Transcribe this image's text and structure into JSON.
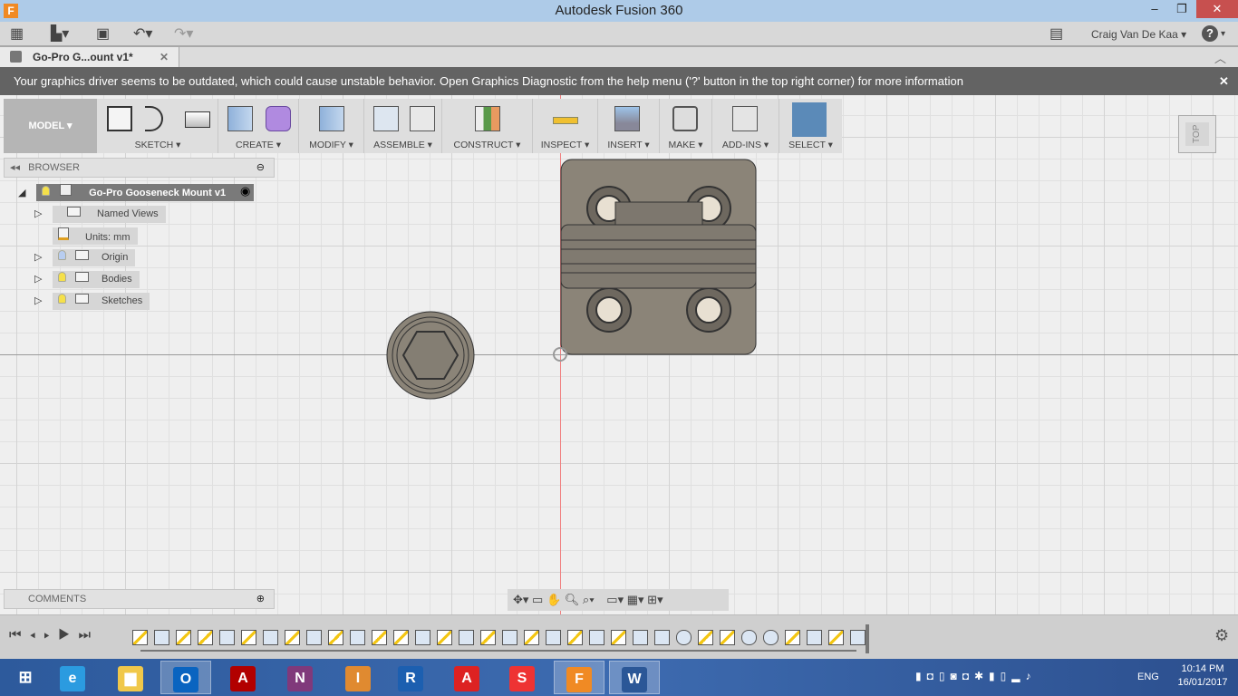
{
  "window": {
    "title": "Autodesk Fusion 360",
    "app_icon_letter": "F",
    "minimize": "‒",
    "restore": "❐",
    "close": "✕"
  },
  "quick_access": {
    "user_name": "Craig Van De Kaa",
    "help": "?"
  },
  "document_tab": {
    "label": "Go-Pro G...ount v1*",
    "close": "✕"
  },
  "banner": {
    "message": "Your graphics driver seems to be outdated, which could cause unstable behavior. Open Graphics Diagnostic from the help menu ('?' button in the top right corner) for more information",
    "close": "✕"
  },
  "toolbar": {
    "workspace": "MODEL ▾",
    "groups": [
      {
        "label": "SKETCH ▾"
      },
      {
        "label": "CREATE ▾"
      },
      {
        "label": "MODIFY ▾"
      },
      {
        "label": "ASSEMBLE ▾"
      },
      {
        "label": "CONSTRUCT ▾"
      },
      {
        "label": "INSPECT ▾"
      },
      {
        "label": "INSERT ▾"
      },
      {
        "label": "MAKE ▾"
      },
      {
        "label": "ADD-INS ▾"
      },
      {
        "label": "SELECT ▾"
      }
    ],
    "accent": "#5b8ab8"
  },
  "viewcube": {
    "label": "TOP"
  },
  "browser": {
    "title": "BROWSER",
    "root": "Go-Pro Gooseneck Mount v1",
    "items": [
      {
        "label": "Named Views",
        "expandable": true,
        "visibility": false
      },
      {
        "label": "Units: mm",
        "expandable": false,
        "visibility": false
      },
      {
        "label": "Origin",
        "expandable": true,
        "visibility": true,
        "bulb": "off"
      },
      {
        "label": "Bodies",
        "expandable": true,
        "visibility": true,
        "bulb": "on"
      },
      {
        "label": "Sketches",
        "expandable": true,
        "visibility": true,
        "bulb": "on"
      }
    ]
  },
  "comments": {
    "title": "COMMENTS"
  },
  "timeline": {
    "features": "SESSESESESESSESESESESESEERSSCRSESE"
  },
  "taskbar": {
    "apps": [
      {
        "name": "internet-explorer",
        "glyph": "e",
        "color": "#2b9be0"
      },
      {
        "name": "file-explorer",
        "glyph": "▆",
        "color": "#f0c84a"
      },
      {
        "name": "outlook",
        "glyph": "O",
        "color": "#0a64c0",
        "active": true
      },
      {
        "name": "acrobat",
        "glyph": "A",
        "color": "#b20000"
      },
      {
        "name": "onenote",
        "glyph": "N",
        "color": "#80397b"
      },
      {
        "name": "inventor",
        "glyph": "I",
        "color": "#e08a30"
      },
      {
        "name": "revit",
        "glyph": "R",
        "color": "#1c5fb0"
      },
      {
        "name": "autocad",
        "glyph": "A",
        "color": "#d22"
      },
      {
        "name": "sketchup",
        "glyph": "S",
        "color": "#e33"
      },
      {
        "name": "fusion-360",
        "glyph": "F",
        "color": "#f08a24",
        "active": true
      },
      {
        "name": "word",
        "glyph": "W",
        "color": "#2b5797",
        "active": true
      }
    ],
    "language": "ENG",
    "time": "10:14 PM",
    "date": "16/01/2017"
  }
}
